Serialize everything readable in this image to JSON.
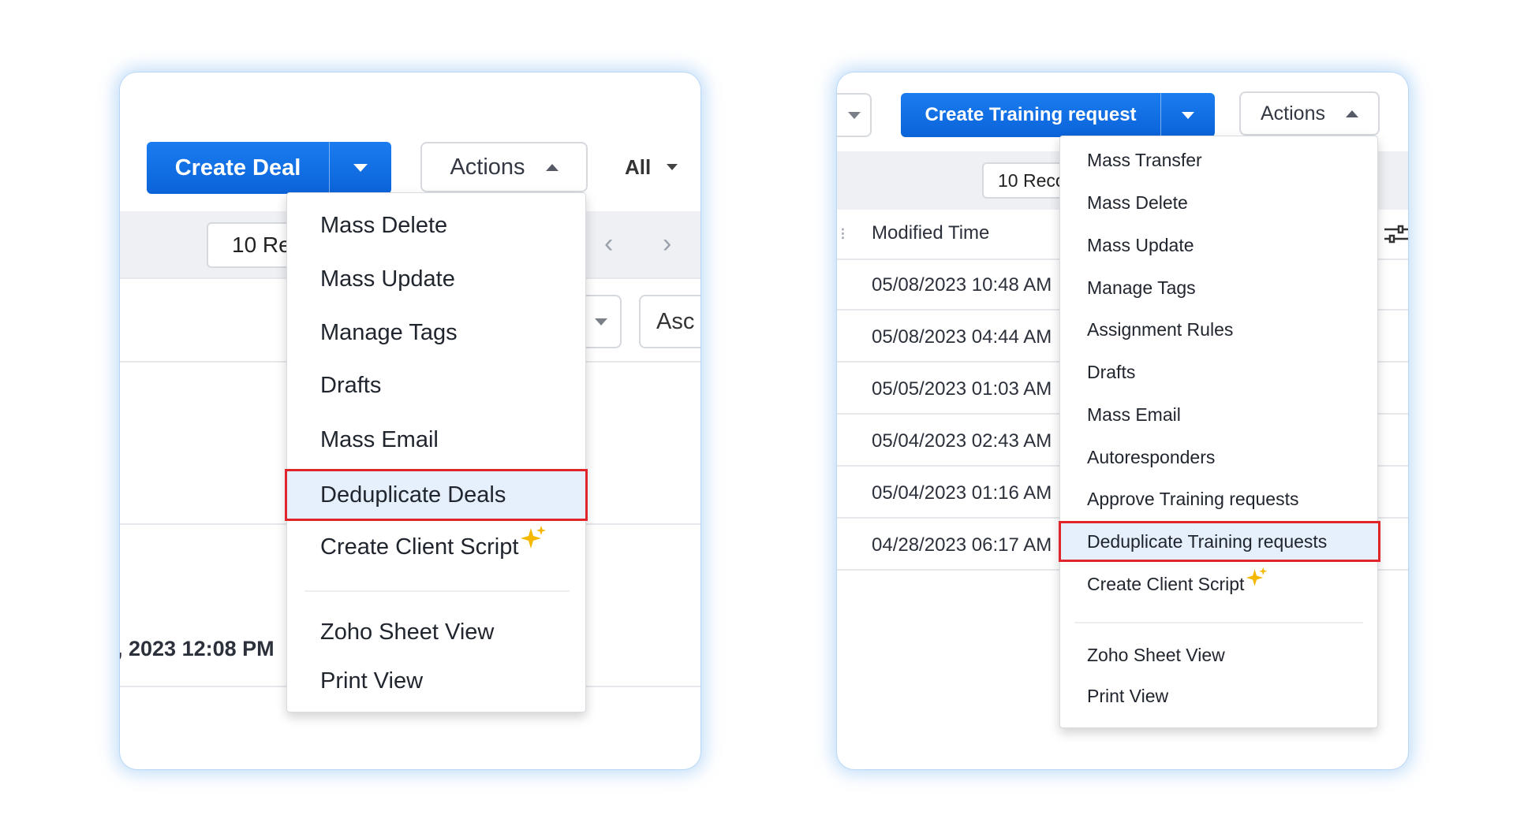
{
  "left_panel": {
    "create_button_label": "Create Deal",
    "actions_label": "Actions",
    "filter_label": "All",
    "records_text": "10 Re",
    "sort_label": "Asc",
    "timestamp_text": ", 2023 12:08 PM",
    "nav_prev_glyph": "‹",
    "nav_next_glyph": "›",
    "menu_items": [
      "Mass Delete",
      "Mass Update",
      "Manage Tags",
      "Drafts",
      "Mass Email",
      "Deduplicate Deals",
      "Create Client Script",
      "Zoho Sheet View",
      "Print View"
    ],
    "highlighted_item": "Deduplicate Deals"
  },
  "right_panel": {
    "create_button_label": "Create Training request",
    "actions_label": "Actions",
    "records_text": "10 Reco",
    "column_header": "Modified Time",
    "rows": [
      "05/08/2023 10:48 AM",
      "05/08/2023 04:44 AM",
      "05/05/2023 01:03 AM",
      "05/04/2023 02:43 AM",
      "05/04/2023 01:16 AM",
      "04/28/2023 06:17 AM"
    ],
    "menu_items": [
      "Mass Transfer",
      "Mass Delete",
      "Mass Update",
      "Manage Tags",
      "Assignment Rules",
      "Drafts",
      "Mass Email",
      "Autoresponders",
      "Approve Training requests",
      "Deduplicate Training requests",
      "Create Client Script",
      "Zoho Sheet View",
      "Print View"
    ],
    "highlighted_item": "Deduplicate Training requests"
  },
  "icons": {
    "sparkle": "✨-style four-point star",
    "column_settings": "sliders-icon"
  },
  "colors": {
    "primary_button": "#0b63d9",
    "highlight_border": "#e0262b",
    "highlight_bg": "#e6f0fc",
    "sparkle": "#f5b800",
    "panel_glow": "#78b4f0"
  }
}
